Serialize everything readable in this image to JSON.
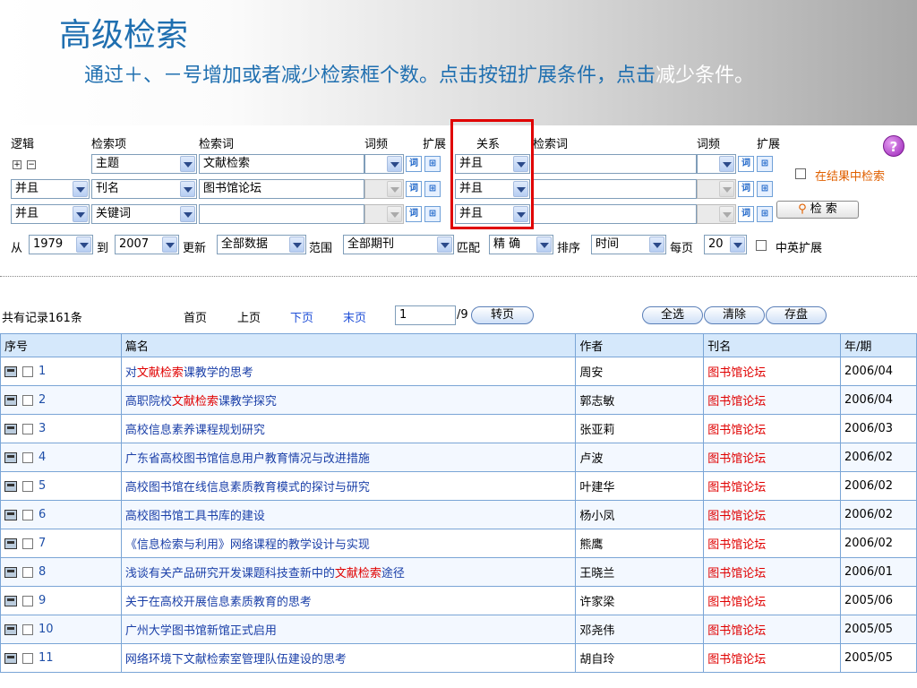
{
  "slide": {
    "title": "高级检索",
    "desc_main": "通过＋、－号增加或者减少检索框个数。点击按钮扩展条件，点击",
    "desc_tail": "减少条件。"
  },
  "form": {
    "headers": {
      "logic": "逻辑",
      "field": "检索项",
      "term": "检索词",
      "freq": "词频",
      "expand": "扩展",
      "relation": "关系",
      "term2": "检索词",
      "freq2": "词频",
      "expand2": "扩展"
    },
    "rows": [
      {
        "logic": "",
        "field": "主题",
        "term": "文献检索",
        "relation": "并且",
        "term2": ""
      },
      {
        "logic": "并且",
        "field": "刊名",
        "term": "图书馆论坛",
        "relation": "并且",
        "term2": ""
      },
      {
        "logic": "并且",
        "field": "关键词",
        "term": "",
        "relation": "并且",
        "term2": ""
      }
    ],
    "search_in_results": "在结果中检索",
    "search_button": "检 索",
    "filters": {
      "from_label": "从",
      "from_value": "1979",
      "to_label": "到",
      "to_value": "2007",
      "update_label": "更新",
      "update_value": "全部数据",
      "scope_label": "范围",
      "scope_value": "全部期刊",
      "match_label": "匹配",
      "match_value": "精 确",
      "sort_label": "排序",
      "sort_value": "时间",
      "perpage_label": "每页",
      "perpage_value": "20",
      "cn_en_label": "中英扩展"
    }
  },
  "results": {
    "total": "共有记录161条",
    "pager": {
      "first": "首页",
      "prev": "上页",
      "next": "下页",
      "last": "末页",
      "page_value": "1",
      "page_total": "/9",
      "goto": "转页"
    },
    "actions": {
      "select_all": "全选",
      "clear": "清除",
      "save": "存盘"
    },
    "columns": [
      "序号",
      "篇名",
      "作者",
      "刊名",
      "年/期"
    ],
    "rows": [
      {
        "no": "1",
        "t1": "对",
        "hl": "文献检索",
        "t2": "课教学的思考",
        "author": "周安",
        "journal": "图书馆论坛",
        "issue": "2006/04"
      },
      {
        "no": "2",
        "t1": "高职院校",
        "hl": "文献检索",
        "t2": "课教学探究",
        "author": "郭志敏",
        "journal": "图书馆论坛",
        "issue": "2006/04"
      },
      {
        "no": "3",
        "t1": "高校信息素养课程规划研究",
        "hl": "",
        "t2": "",
        "author": "张亚莉",
        "journal": "图书馆论坛",
        "issue": "2006/03"
      },
      {
        "no": "4",
        "t1": "广东省高校图书馆信息用户教育情况与改进措施",
        "hl": "",
        "t2": "",
        "author": "卢波",
        "journal": "图书馆论坛",
        "issue": "2006/02"
      },
      {
        "no": "5",
        "t1": "高校图书馆在线信息素质教育模式的探讨与研究",
        "hl": "",
        "t2": "",
        "author": "叶建华",
        "journal": "图书馆论坛",
        "issue": "2006/02"
      },
      {
        "no": "6",
        "t1": "高校图书馆工具书库的建设",
        "hl": "",
        "t2": "",
        "author": "杨小凤",
        "journal": "图书馆论坛",
        "issue": "2006/02"
      },
      {
        "no": "7",
        "t1": "《信息检索与利用》网络课程的教学设计与实现",
        "hl": "",
        "t2": "",
        "author": "熊鹰",
        "journal": "图书馆论坛",
        "issue": "2006/02"
      },
      {
        "no": "8",
        "t1": "浅谈有关产品研究开发课题科技查新中的",
        "hl": "文献检索",
        "t2": "途径",
        "author": "王晓兰",
        "journal": "图书馆论坛",
        "issue": "2006/01"
      },
      {
        "no": "9",
        "t1": "关于在高校开展信息素质教育的思考",
        "hl": "",
        "t2": "",
        "author": "许家梁",
        "journal": "图书馆论坛",
        "issue": "2005/06"
      },
      {
        "no": "10",
        "t1": "广州大学图书馆新馆正式启用",
        "hl": "",
        "t2": "",
        "author": "邓尧伟",
        "journal": "图书馆论坛",
        "issue": "2005/05"
      },
      {
        "no": "11",
        "t1": "网络环境下文献检索室管理队伍建设的思考",
        "hl": "",
        "t2": "",
        "author": "胡自玲",
        "journal": "图书馆论坛",
        "issue": "2005/05"
      }
    ]
  }
}
